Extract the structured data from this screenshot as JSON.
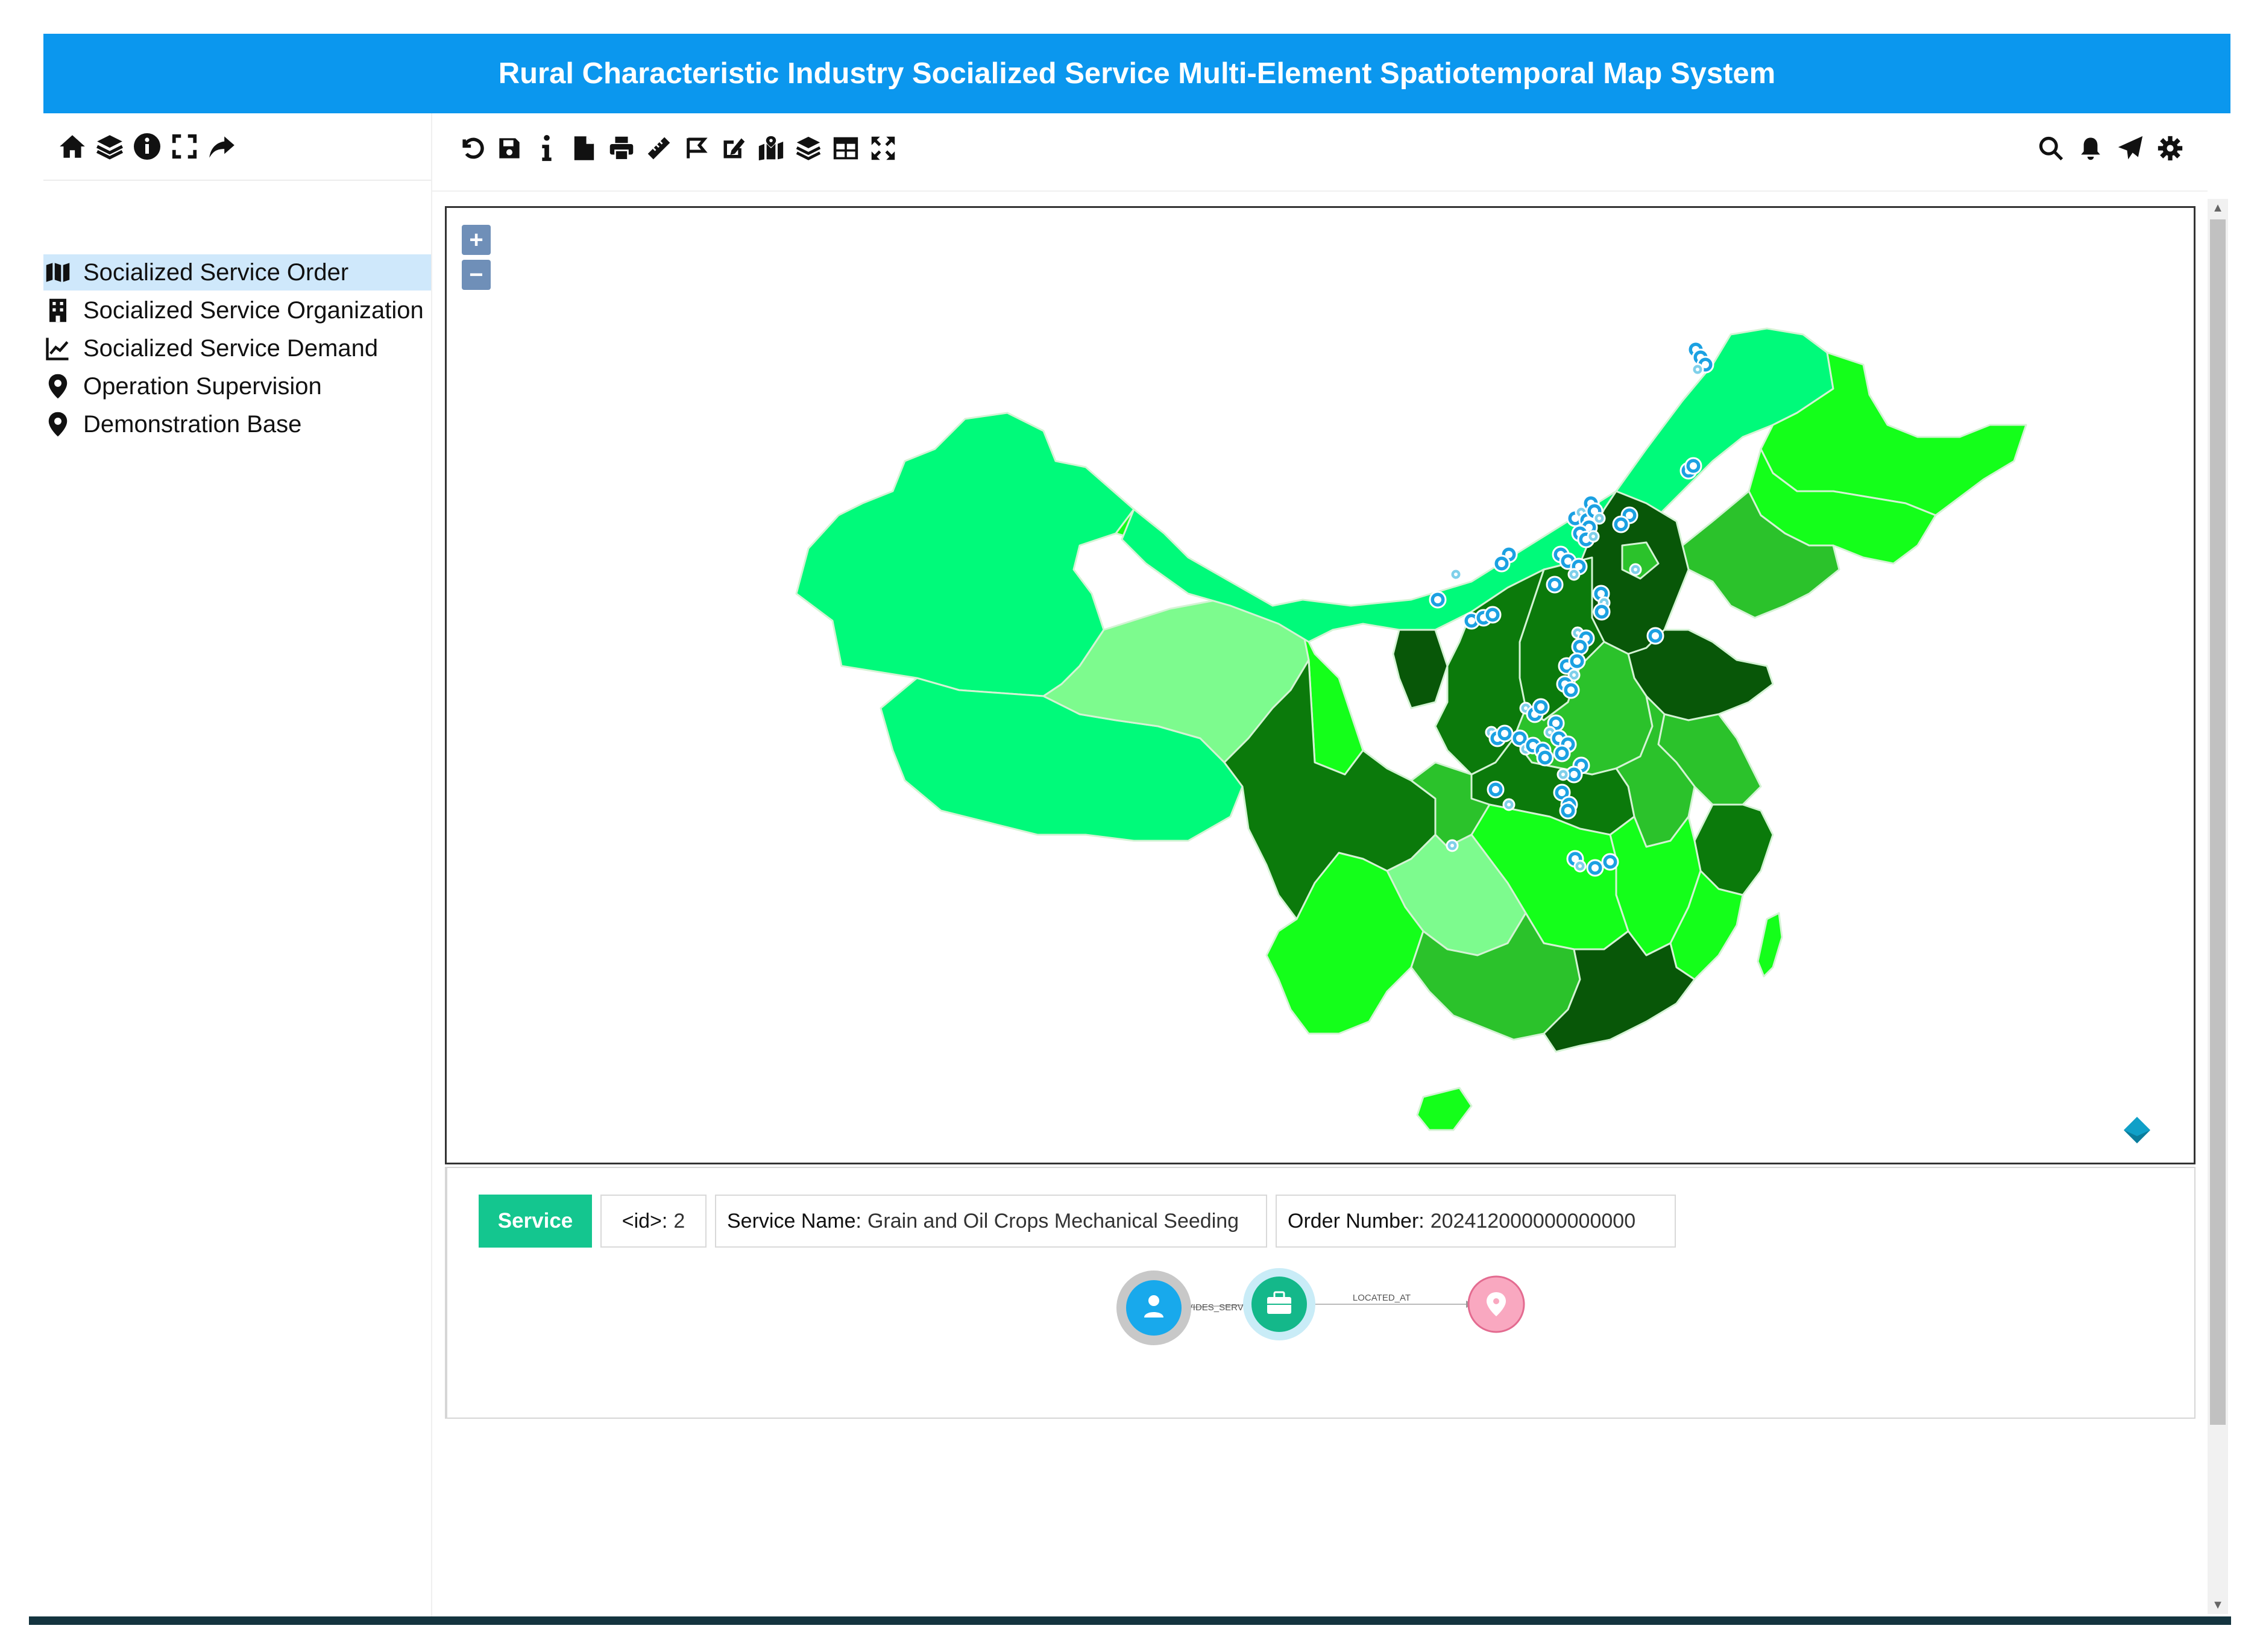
{
  "app": {
    "title": "Rural Characteristic Industry Socialized Service Multi-Element Spatiotemporal Map System"
  },
  "left_toolbar": {
    "icons": [
      "home-icon",
      "layers-icon",
      "info-circle-icon",
      "fullscreen-icon",
      "share-icon"
    ]
  },
  "sidebar": {
    "items": [
      {
        "label": "Socialized Service Order",
        "icon": "map-icon",
        "active": true
      },
      {
        "label": "Socialized Service Organization",
        "icon": "building-icon",
        "active": false
      },
      {
        "label": "Socialized Service Demand",
        "icon": "line-chart-icon",
        "active": false
      },
      {
        "label": "Operation Supervision",
        "icon": "map-marker-icon",
        "active": false
      },
      {
        "label": "Demonstration Base",
        "icon": "map-marker-icon",
        "active": false
      }
    ]
  },
  "main_toolbar": {
    "left_icons": [
      "undo-icon",
      "save-icon",
      "info-icon",
      "file-icon",
      "print-icon",
      "ruler-icon",
      "draw-polygon-icon",
      "edit-icon",
      "map-marked-icon",
      "layers-icon",
      "table-icon",
      "expand-icon"
    ],
    "right_icons": [
      "search-icon",
      "bell-icon",
      "send-icon",
      "gear-icon"
    ]
  },
  "map": {
    "zoom_in_label": "+",
    "zoom_out_label": "−",
    "colors": {
      "light": "#00fa7a",
      "pale": "#7dfb8e",
      "bright": "#14ff1a",
      "medium": "#2bc22b",
      "dark": "#0b7a0b",
      "darkest": "#085708",
      "border": "#d4f3d4",
      "marker": "#1ba1e2"
    }
  },
  "info": {
    "type_label": "Service",
    "id_key": "<id>:",
    "id_value": "2",
    "service_name_key": "Service Name:",
    "service_name_value": "Grain and Oil Crops Mechanical Seeding",
    "order_number_key": "Order Number:",
    "order_number_value": "202412000000000000"
  },
  "graph": {
    "edge1_label": "PROVIDES_SERVICE",
    "edge2_label": "LOCATED_AT",
    "node_colors": {
      "person": "#18a9ec",
      "service": "#14b88a",
      "location": "#f9a8c0"
    }
  }
}
